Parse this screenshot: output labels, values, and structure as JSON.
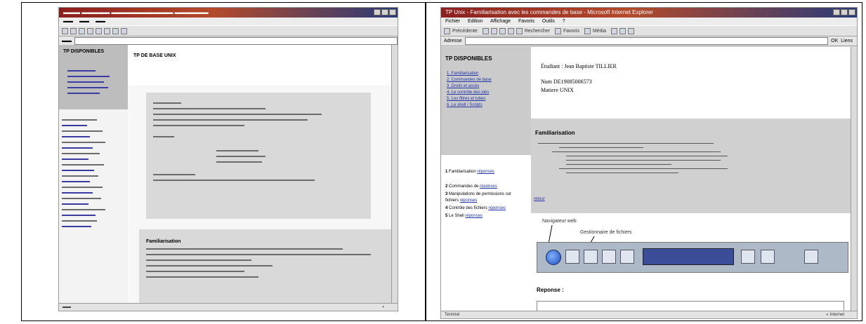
{
  "left_shot": {
    "sidebar_title": "TP DISPONIBLES",
    "content_heading": "TP DE BASE UNIX",
    "content_subheading": "",
    "section_2": "Familiarisation"
  },
  "right_shot": {
    "titlebar": "TP Unix - Familiarisation avec les commandes de base - Microsoft Internet Explorer",
    "menu": [
      "Fichier",
      "Edition",
      "Affichage",
      "Favoris",
      "Outils",
      "?"
    ],
    "toolbar_labels": [
      "Précédente",
      "Rechercher",
      "Favoris",
      "Média"
    ],
    "address_label": "Adresse",
    "go_label": "OK",
    "links_label": "Liens",
    "sidebar_title": "TP DISPONIBLES",
    "sidebar_links": [
      "1. Familiarisation",
      "2. Commandes de base",
      "3. Droits et accès",
      "4. Le contrôle des jobs",
      "5. Les filtres et tubes",
      "6. Le shell / Scripts"
    ],
    "lower_items": [
      {
        "num": "1",
        "text": "Familiarisation",
        "link": "réponses"
      },
      {
        "num": "2",
        "text": "Commandes de",
        "link": "réponses"
      },
      {
        "num": "3",
        "text": "Manipulations de permissions sur fichiers",
        "link": "réponses"
      },
      {
        "num": "4",
        "text": "Contrôle des fichiers",
        "link": "réponses"
      },
      {
        "num": "5",
        "text": "Le Shell",
        "link": "réponses"
      }
    ],
    "header_line1": "Étudiant : Jean Baptiste TILLIER",
    "header_line2": "Num DE19085006573",
    "header_line3": "Matiere UNIX",
    "section_title": "Familiarisation",
    "more_link": "retour",
    "annotation_1": "Navigateur web",
    "annotation_2": "Gestionnaire de fichiers",
    "answer_label": "Reponse :",
    "status_left": "Terminé",
    "status_right": "Internet"
  }
}
